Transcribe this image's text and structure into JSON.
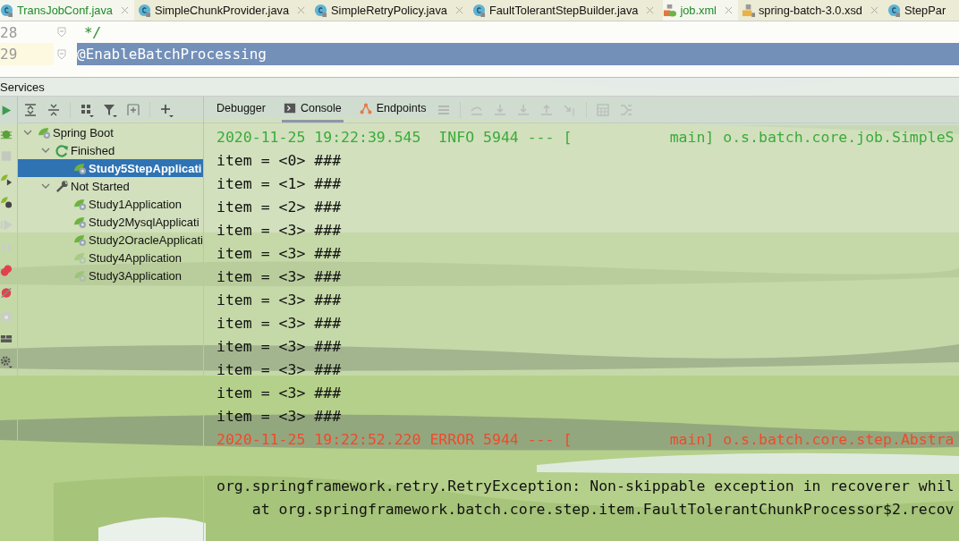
{
  "editor_tabs": [
    {
      "label": "TransJobConf.java",
      "kind": "class",
      "selected": true,
      "modified": true,
      "closable": true
    },
    {
      "label": "SimpleChunkProvider.java",
      "kind": "class",
      "selected": false,
      "modified": false,
      "closable": true
    },
    {
      "label": "SimpleRetryPolicy.java",
      "kind": "class",
      "selected": false,
      "modified": false,
      "closable": true
    },
    {
      "label": "FaultTolerantStepBuilder.java",
      "kind": "class",
      "selected": false,
      "modified": false,
      "closable": true
    },
    {
      "label": "job.xml",
      "kind": "xml",
      "selected": true,
      "modified": true,
      "closable": true
    },
    {
      "label": "spring-batch-3.0.xsd",
      "kind": "xsd",
      "selected": false,
      "modified": false,
      "closable": true
    },
    {
      "label": "StepPar",
      "kind": "class",
      "selected": false,
      "modified": false,
      "closable": false
    }
  ],
  "editor": {
    "lines": [
      {
        "number": "28",
        "text": "*/",
        "kind": "comment",
        "selected": false
      },
      {
        "number": "29",
        "text": "@EnableBatchProcessing",
        "kind": "annotation",
        "selected": true
      }
    ]
  },
  "services": {
    "title": "Services",
    "tree": [
      {
        "label": "Spring Boot",
        "kind": "root",
        "expanded": true,
        "selected": false,
        "children": [
          {
            "label": "Finished",
            "kind": "finished",
            "expanded": true,
            "selected": false,
            "children": [
              {
                "label": "Study5StepApplicati",
                "kind": "app",
                "selected": true,
                "faded": false
              }
            ]
          },
          {
            "label": "Not Started",
            "kind": "not_started",
            "expanded": true,
            "selected": false,
            "children": [
              {
                "label": "Study1Application",
                "kind": "app",
                "selected": false,
                "faded": false
              },
              {
                "label": "Study2MysqlApplicati",
                "kind": "app",
                "selected": false,
                "faded": false
              },
              {
                "label": "Study2OracleApplicati",
                "kind": "app",
                "selected": false,
                "faded": false
              },
              {
                "label": "Study4Application",
                "kind": "app",
                "selected": false,
                "faded": true
              },
              {
                "label": "Study3Application",
                "kind": "app",
                "selected": false,
                "faded": true
              }
            ]
          }
        ]
      }
    ],
    "console_tabs": [
      {
        "label": "Debugger",
        "kind": "plain",
        "selected": false
      },
      {
        "label": "Console",
        "kind": "console",
        "selected": true
      },
      {
        "label": "Endpoints",
        "kind": "endpoints",
        "selected": false
      }
    ],
    "log": [
      {
        "kind": "info",
        "text": "2020-11-25 19:22:39.545  INFO 5944 --- [           main] o.s.batch.core.job.SimpleS"
      },
      {
        "kind": "plain",
        "text": "item = <0> ###"
      },
      {
        "kind": "plain",
        "text": "item = <1> ###"
      },
      {
        "kind": "plain",
        "text": "item = <2> ###"
      },
      {
        "kind": "plain",
        "text": "item = <3> ###"
      },
      {
        "kind": "plain",
        "text": "item = <3> ###"
      },
      {
        "kind": "plain",
        "text": "item = <3> ###"
      },
      {
        "kind": "plain",
        "text": "item = <3> ###"
      },
      {
        "kind": "plain",
        "text": "item = <3> ###"
      },
      {
        "kind": "plain",
        "text": "item = <3> ###"
      },
      {
        "kind": "plain",
        "text": "item = <3> ###"
      },
      {
        "kind": "plain",
        "text": "item = <3> ###"
      },
      {
        "kind": "plain",
        "text": "item = <3> ###"
      },
      {
        "kind": "error",
        "text": "2020-11-25 19:22:52.220 ERROR 5944 --- [           main] o.s.batch.core.step.Abstra"
      },
      {
        "kind": "gap"
      },
      {
        "kind": "plain",
        "text": "org.springframework.retry.RetryException: Non-skippable exception in recoverer whil"
      },
      {
        "kind": "plain",
        "text": "    at org.springframework.batch.core.step.item.FaultTolerantChunkProcessor$2.recov"
      }
    ]
  }
}
